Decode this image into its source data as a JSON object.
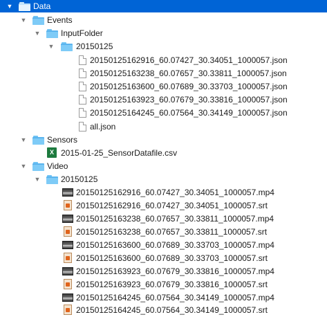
{
  "tree": {
    "root": {
      "name": "Data",
      "disclosure": "▼"
    },
    "events": {
      "name": "Events",
      "disclosure": "▼"
    },
    "input_folder": {
      "name": "InputFolder",
      "disclosure": "▼"
    },
    "events_date": {
      "name": "20150125",
      "disclosure": "▼"
    },
    "json_files": [
      "20150125162916_60.07427_30.34051_1000057.json",
      "20150125163238_60.07657_30.33811_1000057.json",
      "20150125163600_60.07689_30.33703_1000057.json",
      "20150125163923_60.07679_30.33816_1000057.json",
      "20150125164245_60.07564_30.34149_1000057.json",
      "all.json"
    ],
    "sensors": {
      "name": "Sensors",
      "disclosure": "▼"
    },
    "sensor_file": "2015-01-25_SensorDatafile.csv",
    "video": {
      "name": "Video",
      "disclosure": "▼"
    },
    "video_date": {
      "name": "20150125",
      "disclosure": "▼"
    },
    "video_files": [
      {
        "name": "20150125162916_60.07427_30.34051_1000057.mp4",
        "kind": "mp4"
      },
      {
        "name": "20150125162916_60.07427_30.34051_1000057.srt",
        "kind": "srt"
      },
      {
        "name": "20150125163238_60.07657_30.33811_1000057.mp4",
        "kind": "mp4"
      },
      {
        "name": "20150125163238_60.07657_30.33811_1000057.srt",
        "kind": "srt"
      },
      {
        "name": "20150125163600_60.07689_30.33703_1000057.mp4",
        "kind": "mp4"
      },
      {
        "name": "20150125163600_60.07689_30.33703_1000057.srt",
        "kind": "srt"
      },
      {
        "name": "20150125163923_60.07679_30.33816_1000057.mp4",
        "kind": "mp4"
      },
      {
        "name": "20150125163923_60.07679_30.33816_1000057.srt",
        "kind": "srt"
      },
      {
        "name": "20150125164245_60.07564_30.34149_1000057.mp4",
        "kind": "mp4"
      },
      {
        "name": "20150125164245_60.07564_30.34149_1000057.srt",
        "kind": "srt"
      }
    ]
  },
  "colors": {
    "selection": "#0064d6",
    "folder": "#5ab4ee"
  }
}
